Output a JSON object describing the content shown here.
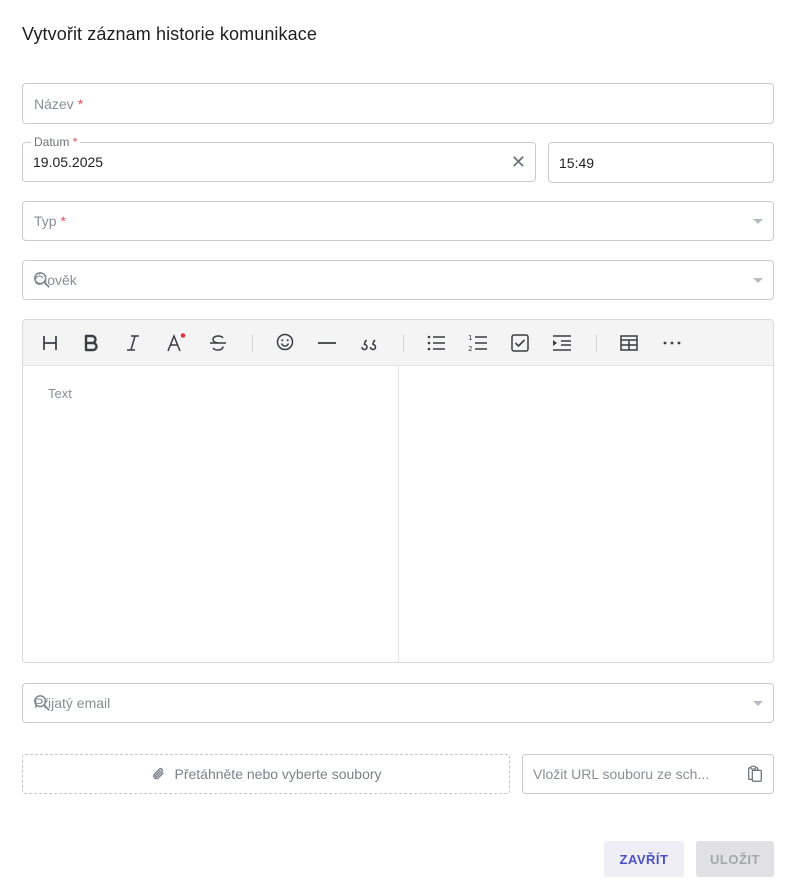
{
  "dialog": {
    "title": "Vytvořit záznam historie komunikace"
  },
  "form": {
    "name": {
      "label": "Název",
      "required_mark": "*"
    },
    "date": {
      "label": "Datum",
      "required_mark": "*",
      "value": "19.05.2025"
    },
    "time": {
      "value": "15:49"
    },
    "type": {
      "label": "Typ",
      "required_mark": "*"
    },
    "person": {
      "placeholder": "Člověk"
    },
    "editor": {
      "placeholder": "Text",
      "toolbar": [
        "heading-icon",
        "bold-icon",
        "italic-icon",
        "text-color-icon",
        "strikethrough-icon",
        "emoji-icon",
        "horizontal-line-icon",
        "quote-icon",
        "bullet-list-icon",
        "numbered-list-icon",
        "task-list-icon",
        "indent-icon",
        "table-icon",
        "more-icon"
      ]
    },
    "received_email": {
      "placeholder": "Přijatý email"
    },
    "attachments": {
      "dropzone_label": "Přetáhněte nebo vyberte soubory",
      "url_placeholder": "Vložit URL souboru ze sch..."
    }
  },
  "actions": {
    "close_label": "ZAVŘÍT",
    "save_label": "ULOŽIT"
  },
  "colors": {
    "required": "#e0535b",
    "primary_text": "#4a50c7",
    "disabled_bg": "#e1e1e3"
  }
}
